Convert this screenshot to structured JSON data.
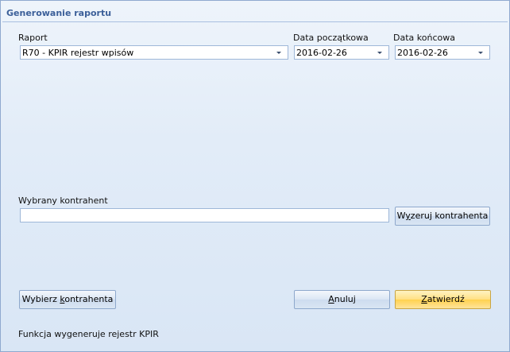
{
  "group_title": "Generowanie raportu",
  "report": {
    "label": "Raport",
    "value": "R70 - KPIR rejestr wpisów"
  },
  "date_start": {
    "label": "Data początkowa",
    "value": "2016-02-26"
  },
  "date_end": {
    "label": "Data końcowa",
    "value": "2016-02-26"
  },
  "contractor": {
    "label": "Wybrany kontrahent",
    "value": "",
    "reset_button_prefix": "W",
    "reset_button_underlined": "y",
    "reset_button_suffix": "zeruj kontrahenta"
  },
  "buttons": {
    "choose_prefix": "Wybierz ",
    "choose_underlined": "k",
    "choose_suffix": "ontrahenta",
    "cancel_underlined": "A",
    "cancel_suffix": "nuluj",
    "confirm_underlined": "Z",
    "confirm_suffix": "atwierdź"
  },
  "status_text": "Funkcja wygeneruje rejestr KPIR"
}
